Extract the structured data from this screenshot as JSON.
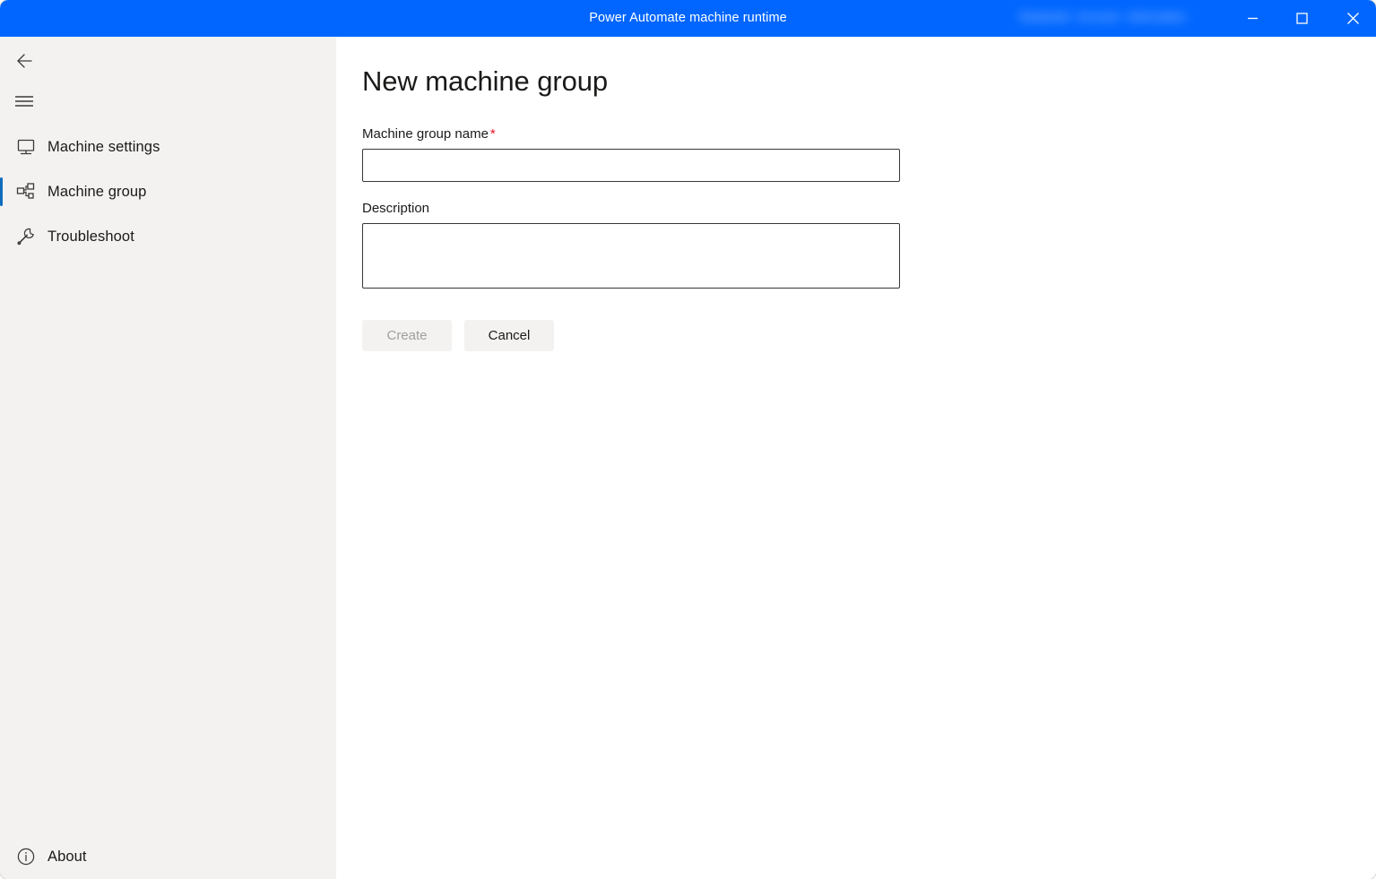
{
  "window": {
    "title": "Power Automate machine runtime",
    "account_blurred": [
      "Redacted",
      "Account",
      "Information"
    ],
    "controls": {
      "minimize": "Minimize",
      "maximize": "Maximize",
      "close": "Close"
    },
    "colors": {
      "titlebar": "#0066FF",
      "sidebar": "#F3F2F1",
      "accent": "#0f6cbd",
      "required_star": "#e81123",
      "text": "#1b1a19",
      "disabled_text": "#a19f9d"
    }
  },
  "sidebar": {
    "back_label": "Back",
    "menu_label": "Navigation menu",
    "items": [
      {
        "label": "Machine settings",
        "icon": "monitor-icon",
        "selected": false
      },
      {
        "label": "Machine group",
        "icon": "machine-group-icon",
        "selected": true
      },
      {
        "label": "Troubleshoot",
        "icon": "wrench-icon",
        "selected": false
      }
    ],
    "about": {
      "label": "About",
      "icon": "info-icon"
    }
  },
  "main": {
    "title": "New machine group",
    "fields": {
      "name": {
        "label": "Machine group name",
        "required_marker": "*",
        "value": "",
        "placeholder": ""
      },
      "description": {
        "label": "Description",
        "value": "",
        "placeholder": ""
      }
    },
    "actions": {
      "create": {
        "label": "Create",
        "disabled": true
      },
      "cancel": {
        "label": "Cancel",
        "disabled": false
      }
    }
  }
}
